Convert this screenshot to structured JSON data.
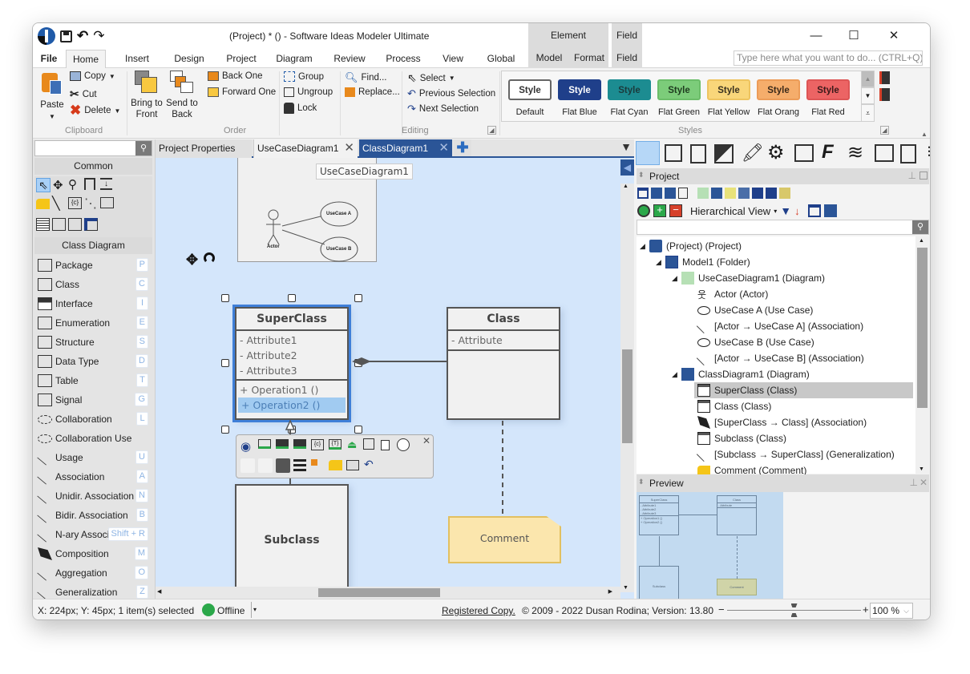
{
  "window": {
    "title": "(Project) * () - Software Ideas Modeler Ultimate",
    "context_headers": [
      "Element",
      "Field"
    ],
    "controls": {
      "minimize": "—",
      "maximize": "☐",
      "close": "✕"
    }
  },
  "ribbon": {
    "tabs": [
      "File",
      "Home",
      "Insert",
      "Design",
      "Project",
      "Diagram",
      "Review",
      "Process",
      "View",
      "Global"
    ],
    "active_tab": "Home",
    "context_tabs": [
      "Model",
      "Format",
      "Field"
    ],
    "search_placeholder": "Type here what you want to do...  (CTRL+Q)",
    "clipboard": {
      "label": "Clipboard",
      "paste": "Paste",
      "copy": "Copy",
      "cut": "Cut",
      "delete": "Delete"
    },
    "order": {
      "label": "Order",
      "bring_to_front": [
        "Bring to",
        "Front"
      ],
      "send_to_back": [
        "Send to",
        "Back"
      ],
      "back_one": "Back One",
      "forward_one": "Forward One",
      "group": "Group",
      "ungroup": "Ungroup",
      "lock": "Lock"
    },
    "editing": {
      "label": "Editing",
      "find": "Find...",
      "replace": "Replace...",
      "select": "Select",
      "previous_selection": "Previous Selection",
      "next_selection": "Next Selection"
    },
    "styles": {
      "label": "Styles",
      "swatch_text": "Style",
      "items": [
        {
          "name": "Default",
          "bg": "#ffffff",
          "fg": "#333333",
          "border": "#666666"
        },
        {
          "name": "Flat Blue",
          "bg": "#1f3f8a",
          "fg": "#ffffff",
          "border": "#1f3f8a"
        },
        {
          "name": "Flat Cyan",
          "bg": "#1c8c91",
          "fg": "#1b3a3c",
          "border": "#1c8c91"
        },
        {
          "name": "Flat Green",
          "bg": "#7ccc7a",
          "fg": "#1f3b1f",
          "border": "#6bbd69"
        },
        {
          "name": "Flat Yellow",
          "bg": "#f9d67a",
          "fg": "#3a3220",
          "border": "#eec460"
        },
        {
          "name": "Flat Orang",
          "bg": "#f5ad6b",
          "fg": "#3b2a1a",
          "border": "#ec9c58"
        },
        {
          "name": "Flat Red",
          "bg": "#ec6464",
          "fg": "#3a1a1a",
          "border": "#dd5555"
        }
      ]
    }
  },
  "toolbox": {
    "search_value": "",
    "sections": {
      "common": "Common",
      "class_diagram": "Class Diagram"
    },
    "items": [
      {
        "label": "Package",
        "key": "P",
        "icon": "package-icon"
      },
      {
        "label": "Class",
        "key": "C",
        "icon": "class-icon"
      },
      {
        "label": "Interface",
        "key": "I",
        "icon": "interface-icon"
      },
      {
        "label": "Enumeration",
        "key": "E",
        "icon": "enumeration-icon"
      },
      {
        "label": "Structure",
        "key": "S",
        "icon": "structure-icon"
      },
      {
        "label": "Data Type",
        "key": "D",
        "icon": "data-type-icon"
      },
      {
        "label": "Table",
        "key": "T",
        "icon": "table-icon"
      },
      {
        "label": "Signal",
        "key": "G",
        "icon": "signal-icon"
      },
      {
        "label": "Collaboration",
        "key": "L",
        "icon": "collaboration-icon"
      },
      {
        "label": "Collaboration Use",
        "key": "",
        "icon": "collaboration-use-icon"
      },
      {
        "label": "Usage",
        "key": "U",
        "icon": "usage-icon"
      },
      {
        "label": "Association",
        "key": "A",
        "icon": "association-icon"
      },
      {
        "label": "Unidir. Association",
        "key": "N",
        "icon": "unidir-association-icon"
      },
      {
        "label": "Bidir. Association",
        "key": "B",
        "icon": "bidir-association-icon"
      },
      {
        "label": "N-ary Associ",
        "key": "Shift + R",
        "icon": "nary-association-icon"
      },
      {
        "label": "Composition",
        "key": "M",
        "icon": "composition-icon"
      },
      {
        "label": "Aggregation",
        "key": "O",
        "icon": "aggregation-icon"
      },
      {
        "label": "Generalization",
        "key": "Z",
        "icon": "generalization-icon"
      }
    ]
  },
  "doc_tabs": [
    {
      "label": "Project Properties",
      "active": false
    },
    {
      "label": "UseCaseDiagram1",
      "active": false
    },
    {
      "label": "ClassDiagram1",
      "active": true
    }
  ],
  "canvas": {
    "tooltip": "UseCaseDiagram1",
    "usecase_thumb": {
      "actor": "Actor",
      "uc_a": "UseCase A",
      "uc_b": "UseCase B"
    },
    "superclass": {
      "name": "SuperClass",
      "attributes": [
        "- Attribute1",
        "- Attribute2",
        "- Attribute3"
      ],
      "operations": [
        "+ Operation1 ()",
        "+ Operation2 ()"
      ],
      "selected_operation": 1
    },
    "class": {
      "name": "Class",
      "attributes": [
        "- Attribute"
      ]
    },
    "subclass": {
      "name": "Subclass"
    },
    "comment": {
      "text": "Comment"
    }
  },
  "right_panel": {
    "project_title": "Project",
    "view_mode": "Hierarchical View",
    "search_value": "",
    "tree": [
      {
        "label": "(Project) (Project)",
        "level": 0,
        "expanded": true,
        "icon": "project-icon"
      },
      {
        "label": "Model1 (Folder)",
        "level": 1,
        "expanded": true,
        "icon": "folder-icon"
      },
      {
        "label": "UseCaseDiagram1 (Diagram)",
        "level": 2,
        "expanded": true,
        "icon": "usecase-diagram-icon"
      },
      {
        "label": "Actor (Actor)",
        "level": 3,
        "icon": "actor-icon"
      },
      {
        "label": "UseCase A (Use Case)",
        "level": 3,
        "icon": "usecase-icon"
      },
      {
        "label": "[Actor → UseCase A] (Association)",
        "level": 3,
        "icon": "association-icon"
      },
      {
        "label": "UseCase B (Use Case)",
        "level": 3,
        "icon": "usecase-icon"
      },
      {
        "label": "[Actor → UseCase B] (Association)",
        "level": 3,
        "icon": "association-icon"
      },
      {
        "label": "ClassDiagram1 (Diagram)",
        "level": 2,
        "expanded": true,
        "icon": "class-diagram-icon"
      },
      {
        "label": "SuperClass (Class)",
        "level": 3,
        "icon": "class-icon",
        "selected": true
      },
      {
        "label": "Class (Class)",
        "level": 3,
        "icon": "class-icon"
      },
      {
        "label": "[SuperClass → Class] (Association)",
        "level": 3,
        "icon": "composition-icon"
      },
      {
        "label": "Subclass (Class)",
        "level": 3,
        "icon": "class-icon"
      },
      {
        "label": "[Subclass → SuperClass] (Generalization)",
        "level": 3,
        "icon": "generalization-icon"
      },
      {
        "label": "Comment (Comment)",
        "level": 3,
        "icon": "comment-icon"
      }
    ],
    "preview_title": "Preview",
    "preview": {
      "superclass": "SuperClass",
      "class": "Class",
      "subclass": "Subclass",
      "comment": "Comment",
      "attrs": [
        "- Attribute1",
        "- Attribute2",
        "- Attribute3"
      ],
      "ops": [
        "+ Operation1 ()",
        "+ Operation2 ()"
      ],
      "class_attr": "- Attribute"
    }
  },
  "status": {
    "position": "X: 224px; Y: 45px; 1 item(s) selected",
    "connection": "Offline",
    "registered": "Registered Copy.",
    "copyright": "© 2009 - 2022 Dusan Rodina; Version: 13.80",
    "zoom": "100 %",
    "zoom_fraction": 0.5
  }
}
